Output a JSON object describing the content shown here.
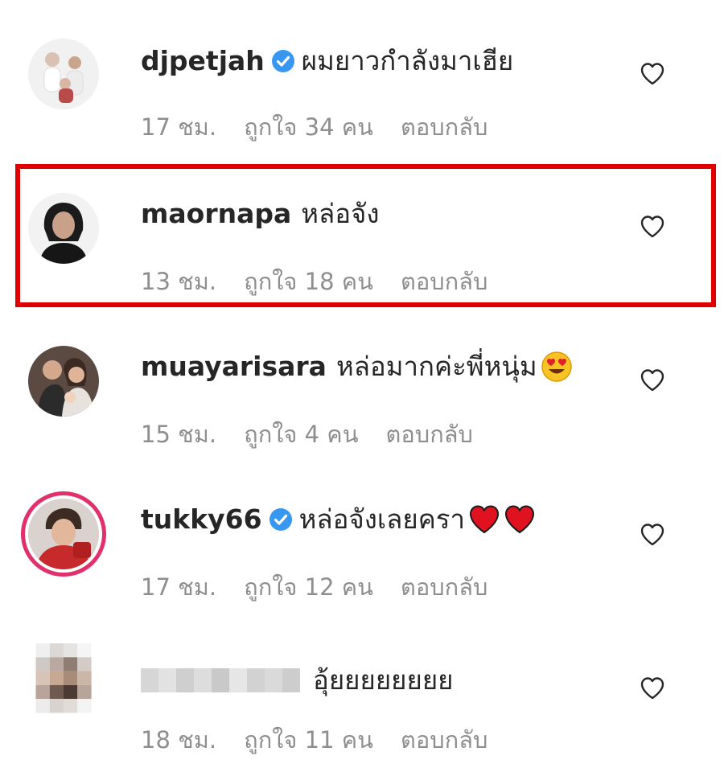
{
  "colors": {
    "highlight_border": "#e00000",
    "meta_text": "#8e8e8e",
    "verified_badge": "#3897f0",
    "story_ring": "#e1306c"
  },
  "comments": [
    {
      "username": "djpetjah",
      "verified": true,
      "text": "ผมยาวกำลังมาเฮีย",
      "time": "17 ชม.",
      "likes": "ถูกใจ 34 คน",
      "reply": "ตอบกลับ",
      "icon": "heart-outline-icon"
    },
    {
      "username": "maornapa",
      "verified": false,
      "text": "หล่อจัง",
      "time": "13 ชม.",
      "likes": "ถูกใจ 18 คน",
      "reply": "ตอบกลับ",
      "icon": "heart-outline-icon",
      "highlighted": true
    },
    {
      "username": "muayarisara",
      "verified": false,
      "text": "หล่อมากค่ะพี่หนุ่ม",
      "emoji": "heart-eyes-emoji",
      "time": "15 ชม.",
      "likes": "ถูกใจ 4 คน",
      "reply": "ตอบกลับ",
      "icon": "heart-outline-icon"
    },
    {
      "username": "tukky66",
      "verified": true,
      "text": "หล่อจังเลยครา",
      "emoji": "red-heart-emoji x2",
      "time": "17 ชม.",
      "likes": "ถูกใจ 12 คน",
      "reply": "ตอบกลับ",
      "icon": "heart-outline-icon"
    },
    {
      "username": "",
      "username_blurred": true,
      "verified": false,
      "text": "อุ้ยยยยยยยย",
      "time": "18 ชม.",
      "likes": "ถูกใจ 11 คน",
      "reply": "ตอบกลับ",
      "icon": "heart-outline-icon"
    }
  ]
}
